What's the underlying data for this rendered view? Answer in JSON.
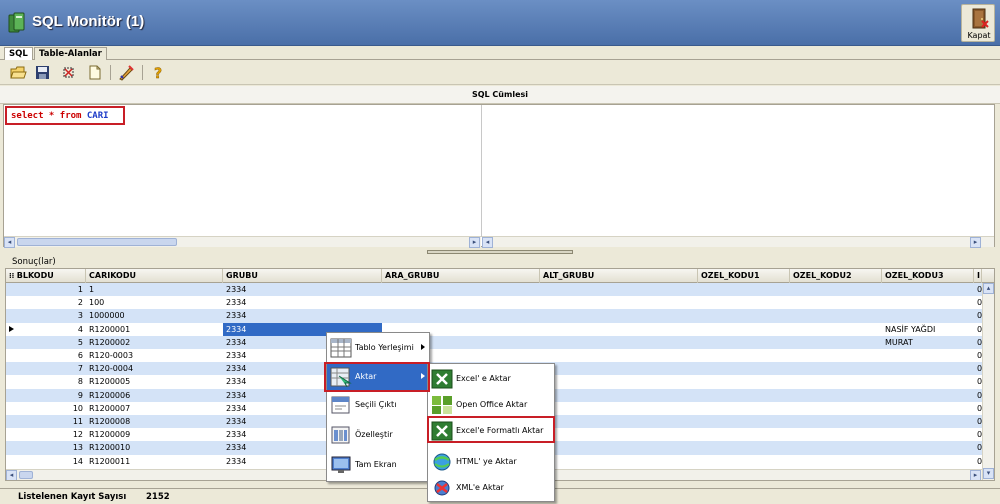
{
  "window": {
    "title": "SQL Monitör (1)",
    "close_label": "Kapat"
  },
  "tabs": [
    {
      "label": "SQL",
      "active": true
    },
    {
      "label": "Table-Alanlar",
      "active": false
    }
  ],
  "toolbar": {
    "buttons": [
      "open-icon",
      "save-icon",
      "clear-icon",
      "new-icon",
      "edit-icon",
      "help-icon"
    ]
  },
  "sql_panel": {
    "caption": "SQL Cümlesi",
    "query_keyword1": "select",
    "query_star": " * ",
    "query_keyword2": "from",
    "query_table": " CARI"
  },
  "results": {
    "label": "Sonuç(lar)",
    "columns": [
      "BLKODU",
      "CARIKODU",
      "GRUBU",
      "ARA_GRUBU",
      "ALT_GRUBU",
      "OZEL_KODU1",
      "OZEL_KODU2",
      "OZEL_KODU3",
      "I"
    ],
    "rows": [
      {
        "blkodu": "1",
        "carikodu": "1",
        "grubu": "2334",
        "ozel3": "",
        "extra": "0"
      },
      {
        "blkodu": "2",
        "carikodu": "100",
        "grubu": "2334",
        "ozel3": "",
        "extra": "0"
      },
      {
        "blkodu": "3",
        "carikodu": "1000000",
        "grubu": "2334",
        "ozel3": "",
        "extra": "0"
      },
      {
        "blkodu": "4",
        "carikodu": "R1200001",
        "grubu": "2334",
        "ozel3": "NASİF YAĞDI",
        "extra": "0"
      },
      {
        "blkodu": "5",
        "carikodu": "R1200002",
        "grubu": "2334",
        "ozel3": "MURAT",
        "extra": "0"
      },
      {
        "blkodu": "6",
        "carikodu": "R120-0003",
        "grubu": "2334",
        "ozel3": "",
        "extra": "0"
      },
      {
        "blkodu": "7",
        "carikodu": "R120-0004",
        "grubu": "2334",
        "ozel3": "",
        "extra": "0"
      },
      {
        "blkodu": "8",
        "carikodu": "R1200005",
        "grubu": "2334",
        "ozel3": "",
        "extra": "0"
      },
      {
        "blkodu": "9",
        "carikodu": "R1200006",
        "grubu": "2334",
        "ozel3": "",
        "extra": "0"
      },
      {
        "blkodu": "10",
        "carikodu": "R1200007",
        "grubu": "2334",
        "ozel3": "",
        "extra": "0"
      },
      {
        "blkodu": "11",
        "carikodu": "R1200008",
        "grubu": "2334",
        "ozel3": "",
        "extra": "0"
      },
      {
        "blkodu": "12",
        "carikodu": "R1200009",
        "grubu": "2334",
        "ozel3": "",
        "extra": "0"
      },
      {
        "blkodu": "13",
        "carikodu": "R1200010",
        "grubu": "2334",
        "ozel3": "",
        "extra": "0"
      },
      {
        "blkodu": "14",
        "carikodu": "R1200011",
        "grubu": "2334",
        "ozel3": "",
        "extra": "0"
      }
    ],
    "selected_row": 4
  },
  "context_menu": {
    "items": [
      {
        "label": "Tablo Yerleşimi",
        "icon": "table-layout-icon",
        "submenu": true
      },
      {
        "label": "Aktar",
        "icon": "export-icon",
        "submenu": true,
        "active": true
      },
      {
        "label": "Seçili Çıktı",
        "icon": "selected-print-icon",
        "submenu": false
      },
      {
        "label": "Özelleştir",
        "icon": "customize-icon",
        "submenu": false
      },
      {
        "label": "Tam Ekran",
        "icon": "fullscreen-icon",
        "submenu": false
      }
    ]
  },
  "export_submenu": {
    "items": [
      {
        "label": "Excel' e Aktar",
        "icon": "excel-icon"
      },
      {
        "label": "Open Office Aktar",
        "icon": "open-office-icon"
      },
      {
        "label": "Excel'e Formatlı Aktar",
        "icon": "excel-formatted-icon"
      },
      {
        "label": "HTML' ye Aktar",
        "icon": "html-icon"
      },
      {
        "label": "XML'e Aktar",
        "icon": "xml-icon"
      }
    ]
  },
  "status": {
    "label": "Listelenen Kayıt Sayısı",
    "value": "2152"
  },
  "colors": {
    "highlight_red": "#c81e26",
    "selection_blue": "#316ac5",
    "row_alt": "#d4e3f7",
    "title_blue": "#4a6fa8"
  }
}
